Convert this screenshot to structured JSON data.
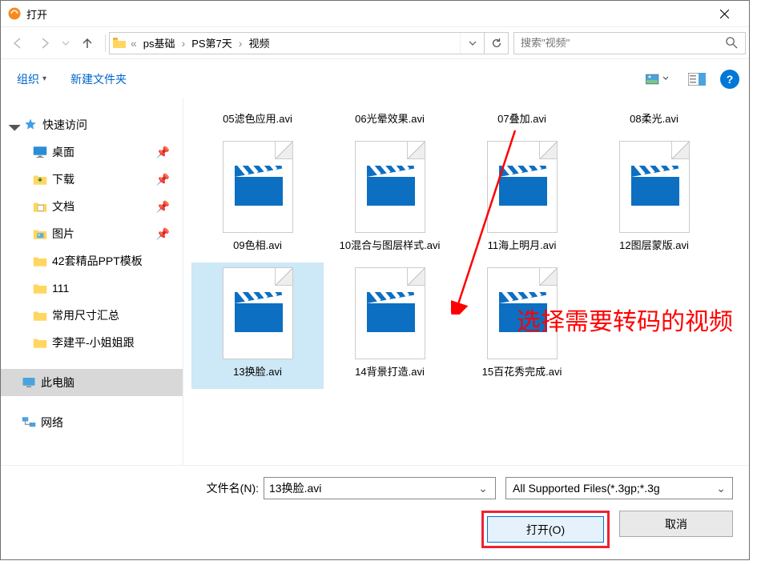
{
  "title": "打开",
  "breadcrumbs": {
    "prefix": "«",
    "b1": "ps基础",
    "b2": "PS第7天",
    "b3": "视频"
  },
  "search_placeholder": "搜索\"视频\"",
  "toolbar": {
    "organize": "组织",
    "newfolder": "新建文件夹"
  },
  "sidebar": {
    "quick": "快速访问",
    "desktop": "桌面",
    "downloads": "下载",
    "documents": "文档",
    "pictures": "图片",
    "ppt": "42套精品PPT模板",
    "i111": "111",
    "size": "常用尺寸汇总",
    "li": "李建平-小姐姐跟",
    "thispc": "此电脑",
    "network": "网络"
  },
  "files": {
    "f05": "05滤色应用.avi",
    "f06": "06光晕效果.avi",
    "f07": "07叠加.avi",
    "f08": "08柔光.avi",
    "f09": "09色相.avi",
    "f10": "10混合与图层样式.avi",
    "f11": "11海上明月.avi",
    "f12": "12图层蒙版.avi",
    "f13": "13换脸.avi",
    "f14": "14背景打造.avi",
    "f15": "15百花秀完成.avi"
  },
  "annotation": "选择需要转码的视频",
  "filename_label": "文件名(N):",
  "filename_value": "13换脸.avi",
  "filter_text": "All Supported Files(*.3gp;*.3g",
  "btn_open": "打开(O)",
  "btn_cancel": "取消"
}
